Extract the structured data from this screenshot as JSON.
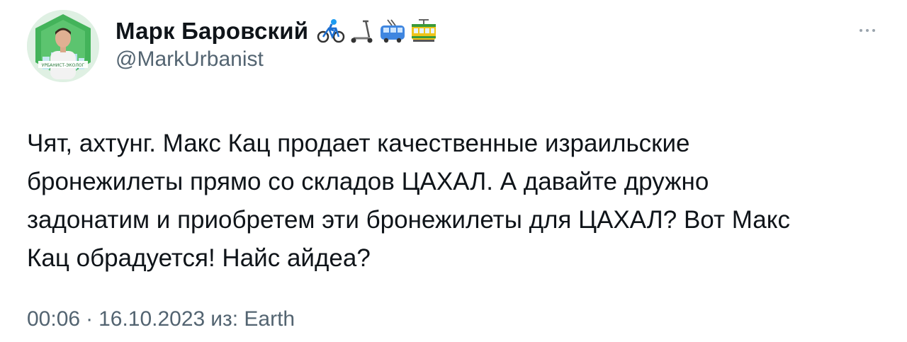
{
  "author": {
    "display_name": "Марк Баровский",
    "handle": "@MarkUrbanist",
    "avatar_caption": "УРБАНИСТ-ЭКОЛОГ",
    "name_emojis": [
      "bicycle-icon",
      "scooter-icon",
      "trolleybus-icon",
      "tram-icon"
    ]
  },
  "more_icon": "ellipsis-icon",
  "tweet": {
    "lines": [
      "Чят, ахтунг. Макс Кац продает качественные израильские",
      "бронежилеты прямо со складов ЦАХАЛ. А давайте дружно",
      "задонатим и приобретем эти бронежилеты для ЦАХАЛ? Вот Макс",
      "Кац обрадуется! Найс айдеа?"
    ]
  },
  "meta": {
    "time": "00:06",
    "separator": "·",
    "date": "16.10.2023",
    "source": "из: Earth"
  },
  "colors": {
    "text": "#0f1419",
    "secondary": "#536471",
    "avatar_bg": "#2ea043"
  }
}
